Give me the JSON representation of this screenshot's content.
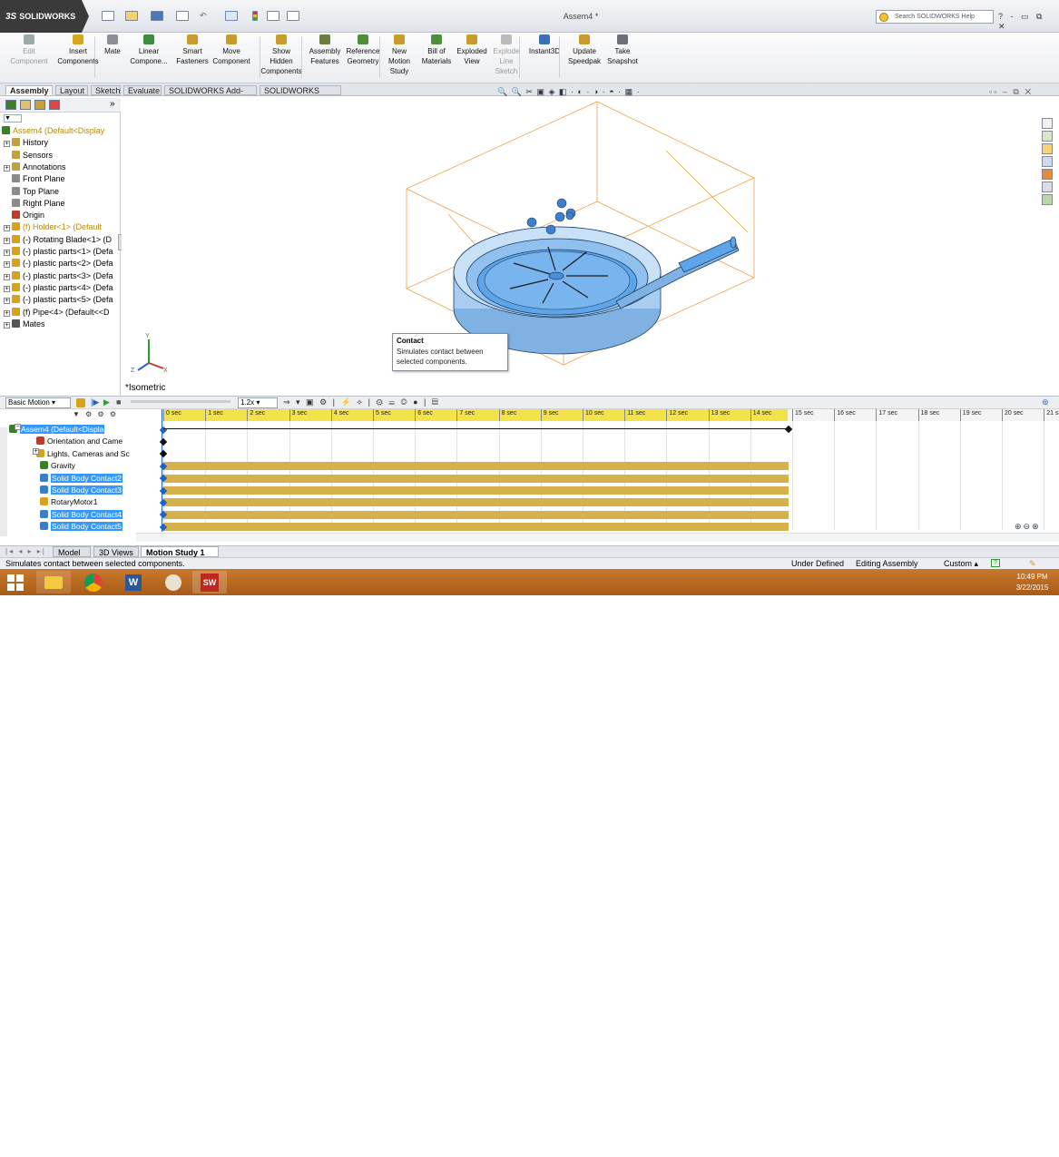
{
  "app": {
    "logo": "SOLIDWORKS",
    "logo_ds": "3S",
    "doc_title": "Assem4 *",
    "search_placeholder": "Search SOLIDWORKS Help",
    "window_controls": "? - ▭ ⧉ ✕"
  },
  "commands": [
    {
      "label": "Edit Component",
      "lines": [
        "Edit",
        "Component"
      ],
      "disabled": true,
      "color": "#9aa"
    },
    {
      "label": "Insert Components",
      "lines": [
        "Insert",
        "Components"
      ],
      "color": "#d8a720"
    },
    {
      "label": "Mate",
      "lines": [
        "Mate"
      ],
      "color": "#8a8f98"
    },
    {
      "label": "Linear Component...",
      "lines": [
        "Linear",
        "Compone..."
      ],
      "color": "#3c8f3c"
    },
    {
      "label": "Smart Fasteners",
      "lines": [
        "Smart",
        "Fasteners"
      ],
      "color": "#c99b2c"
    },
    {
      "label": "Move Component",
      "lines": [
        "Move",
        "Component"
      ],
      "color": "#c99b2c"
    },
    {
      "label": "Show Hidden Components",
      "lines": [
        "Show",
        "Hidden",
        "Components"
      ],
      "color": "#c99b2c"
    },
    {
      "label": "Assembly Features",
      "lines": [
        "Assembly",
        "Features"
      ],
      "color": "#6a7d3c"
    },
    {
      "label": "Reference Geometry",
      "lines": [
        "Reference",
        "Geometry"
      ],
      "color": "#4e8f3c"
    },
    {
      "label": "New Motion Study",
      "lines": [
        "New",
        "Motion",
        "Study"
      ],
      "color": "#c99b2c"
    },
    {
      "label": "Bill of Materials",
      "lines": [
        "Bill of",
        "Materials"
      ],
      "color": "#4e8f3c"
    },
    {
      "label": "Exploded View",
      "lines": [
        "Exploded",
        "View"
      ],
      "color": "#c99b2c"
    },
    {
      "label": "Explode Line Sketch",
      "lines": [
        "Explode",
        "Line",
        "Sketch"
      ],
      "disabled": true,
      "color": "#bbb"
    },
    {
      "label": "Instant3D",
      "lines": [
        "Instant3D"
      ],
      "color": "#3d6fb5"
    },
    {
      "label": "Update Speedpak",
      "lines": [
        "Update",
        "Speedpak"
      ],
      "color": "#c99b2c"
    },
    {
      "label": "Take Snapshot",
      "lines": [
        "Take",
        "Snapshot"
      ],
      "color": "#6a6f78"
    }
  ],
  "tabs": [
    "Assembly",
    "Layout",
    "Sketch",
    "Evaluate",
    "SOLIDWORKS Add-Ins",
    "SOLIDWORKS MBD"
  ],
  "tree": {
    "items": [
      {
        "label": "Assem4  (Default<Display",
        "color": "#b58a0a",
        "icon": "#3b7f2b",
        "exp": ""
      },
      {
        "label": "History",
        "icon": "#c6a03a",
        "exp": "+"
      },
      {
        "label": "Sensors",
        "icon": "#c6a03a",
        "exp": ""
      },
      {
        "label": "Annotations",
        "icon": "#c6a03a",
        "exp": "+"
      },
      {
        "label": "Front Plane",
        "icon": "#8b8b8b",
        "exp": ""
      },
      {
        "label": "Top Plane",
        "icon": "#8b8b8b",
        "exp": ""
      },
      {
        "label": "Right Plane",
        "icon": "#8b8b8b",
        "exp": ""
      },
      {
        "label": "Origin",
        "icon": "#c0392b",
        "exp": ""
      },
      {
        "label": "(f) Holder<1> (Default",
        "color": "#b58a0a",
        "icon": "#d9a21b",
        "exp": "+"
      },
      {
        "label": "(-) Rotating Blade<1> (D",
        "icon": "#d9a21b",
        "exp": "+"
      },
      {
        "label": "(-) plastic parts<1> (Defa",
        "icon": "#d9a21b",
        "exp": "+"
      },
      {
        "label": "(-) plastic parts<2> (Defa",
        "icon": "#d9a21b",
        "exp": "+"
      },
      {
        "label": "(-) plastic parts<3> (Defa",
        "icon": "#d9a21b",
        "exp": "+"
      },
      {
        "label": "(-) plastic parts<4> (Defa",
        "icon": "#d9a21b",
        "exp": "+"
      },
      {
        "label": "(-) plastic parts<5> (Defa",
        "icon": "#d9a21b",
        "exp": "+"
      },
      {
        "label": "(f) Pipe<4> (Default<<D",
        "icon": "#d9a21b",
        "exp": "+"
      },
      {
        "label": "Mates",
        "icon": "#555",
        "exp": "+"
      }
    ]
  },
  "viewport": {
    "view_label": "*Isometric",
    "toolbar_glyphs": "🔍 🔍 ✂ ▣ ◈ ◧ · ◐ · ◑ · ◓ · ▦ ·"
  },
  "tooltip": {
    "title": "Contact",
    "text": "Simulates contact between selected components."
  },
  "motion": {
    "study_type": "Basic Motion",
    "zoom": "1.2x",
    "time_labels": [
      "0 sec",
      "1 sec",
      "2 sec",
      "3 sec",
      "4 sec",
      "5 sec",
      "6 sec",
      "7 sec",
      "8 sec",
      "9 sec",
      "10 sec",
      "11 sec",
      "12 sec",
      "13 sec",
      "14 sec",
      "15 sec",
      "16 sec",
      "17 sec",
      "18 sec",
      "19 sec",
      "20 sec",
      "21 s"
    ],
    "rows": [
      {
        "label": "Assem4  (Default<Displa",
        "highlight": true,
        "icon": "#3b7f2b",
        "bar": false
      },
      {
        "label": "Orientation and Came",
        "highlight": false,
        "icon": "#c0392b",
        "bar": false
      },
      {
        "label": "Lights, Cameras and Sc",
        "highlight": false,
        "icon": "#d9a21b",
        "bar": false
      },
      {
        "label": "Gravity",
        "highlight": false,
        "icon": "#3b7f2b",
        "bar": true
      },
      {
        "label": "Solid Body Contact2",
        "highlight": true,
        "icon": "#3a7ec6",
        "bar": true
      },
      {
        "label": "Solid Body Contact3",
        "highlight": true,
        "icon": "#3a7ec6",
        "bar": true
      },
      {
        "label": "RotaryMotor1",
        "highlight": false,
        "icon": "#d9a21b",
        "bar": true
      },
      {
        "label": "Solid Body Contact4",
        "highlight": true,
        "icon": "#3a7ec6",
        "bar": true
      },
      {
        "label": "Solid Body Contact5",
        "highlight": true,
        "icon": "#3a7ec6",
        "bar": true
      }
    ],
    "tabs": [
      "Model",
      "3D Views",
      "Motion Study 1"
    ]
  },
  "status": {
    "message": "Simulates contact between selected components.",
    "state": "Under Defined",
    "mode": "Editing Assembly",
    "units": "Custom"
  },
  "taskbar": {
    "time": "10:49 PM",
    "date": "3/22/2015"
  }
}
